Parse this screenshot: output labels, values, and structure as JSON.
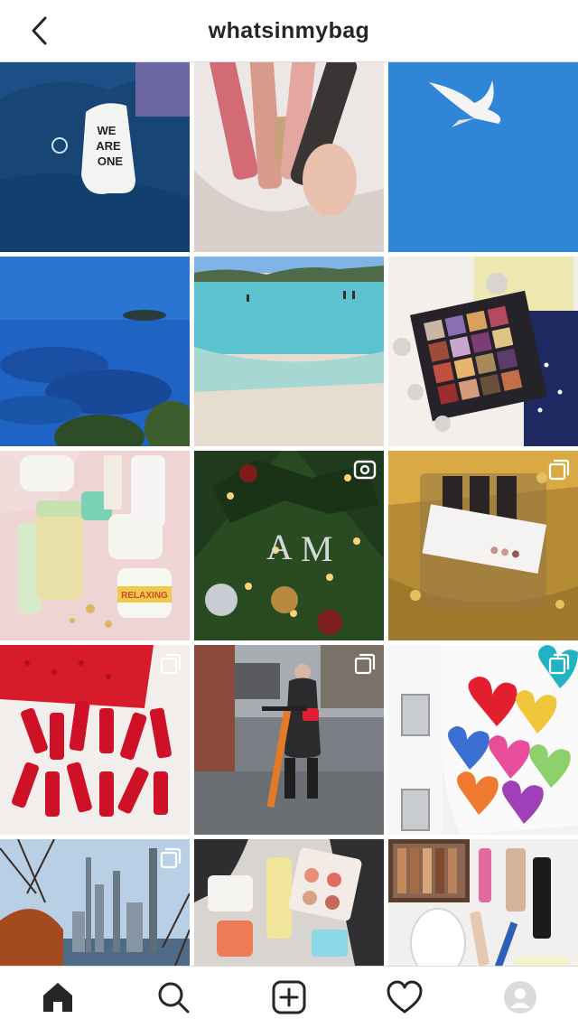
{
  "header": {
    "title": "whatsinmybag"
  },
  "colors": {
    "text": "#262626",
    "divider": "#dbdbdb",
    "background": "#ffffff"
  },
  "grid": {
    "posts": [
      {
        "name": "post-we-are-one-sock",
        "badge": "none"
      },
      {
        "name": "post-lip-gloss-hand",
        "badge": "none"
      },
      {
        "name": "post-seagull-sky",
        "badge": "none"
      },
      {
        "name": "post-blue-sea-coast",
        "badge": "none"
      },
      {
        "name": "post-beach-shallow-water",
        "badge": "none"
      },
      {
        "name": "post-eyeshadow-palette",
        "badge": "none"
      },
      {
        "name": "post-skincare-products",
        "badge": "none"
      },
      {
        "name": "post-christmas-tree",
        "badge": "igtv"
      },
      {
        "name": "post-gold-sequin-package",
        "badge": "multiple"
      },
      {
        "name": "post-red-lipsticks",
        "badge": "multiple"
      },
      {
        "name": "post-scooter-street",
        "badge": "multiple"
      },
      {
        "name": "post-heart-mural",
        "badge": "multiple"
      },
      {
        "name": "post-central-park-skyline",
        "badge": "multiple"
      },
      {
        "name": "post-beauty-flatlay",
        "badge": "none"
      },
      {
        "name": "post-makeup-flatlay",
        "badge": "none"
      }
    ]
  },
  "tabbar": {
    "tabs": [
      {
        "icon": "home-icon",
        "active": true
      },
      {
        "icon": "search-icon",
        "active": false
      },
      {
        "icon": "add-post-icon",
        "active": false
      },
      {
        "icon": "heart-icon",
        "active": false
      },
      {
        "icon": "profile-avatar-icon",
        "active": false
      }
    ]
  }
}
